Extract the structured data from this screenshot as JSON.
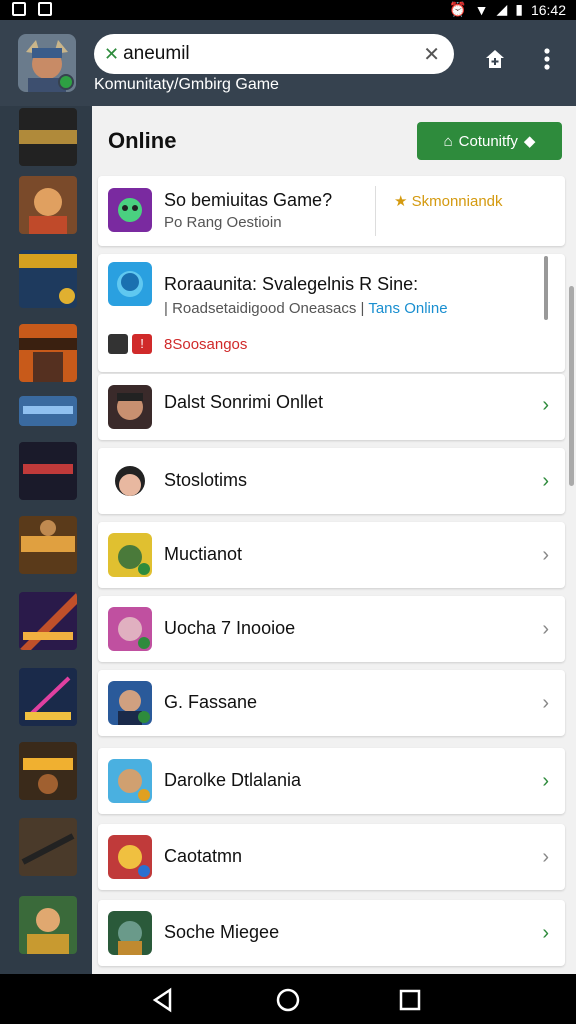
{
  "status_bar": {
    "time": "16:42"
  },
  "appbar": {
    "search_query": "aneumil",
    "subtitle": "Komunitaty/Gmbirg Game",
    "icons": [
      "plus-icon",
      "clear-icon",
      "add-home-icon",
      "more-vert-icon"
    ]
  },
  "main": {
    "title": "Online",
    "community_button": "Cotunitfy"
  },
  "featured_card": {
    "title": "So bemiuitas Game?",
    "subtitle": "Po Rang Oestioin",
    "side_label": "Skmonniandk"
  },
  "second_card": {
    "title": "Roraaunita: Svalegelnis R Sine:",
    "text1": "Roadsetaidigood Oneasacs",
    "text2": "Tans Online",
    "warning": "8Soosangos"
  },
  "list_items": [
    {
      "title": "Dalst Sonrimi Onllet",
      "chevron": "green"
    },
    {
      "title": "Stoslotims",
      "chevron": "green"
    },
    {
      "title": "Muctianot",
      "chevron": "gray"
    },
    {
      "title": "Uocha 7 Inooioe",
      "chevron": "gray"
    },
    {
      "title": "G. Fassane",
      "chevron": "gray"
    },
    {
      "title": "Darolke Dtlalania",
      "chevron": "green"
    },
    {
      "title": "Caotatmn",
      "chevron": "gray"
    },
    {
      "title": "Soche Miegee",
      "chevron": "green"
    }
  ],
  "colors": {
    "appbar": "#36424f",
    "accent_green": "#2e8b3c",
    "rail": "#2f3b47",
    "link_blue": "#1a8fd0",
    "warning_red": "#d02a2a",
    "gold": "#d49a10"
  }
}
